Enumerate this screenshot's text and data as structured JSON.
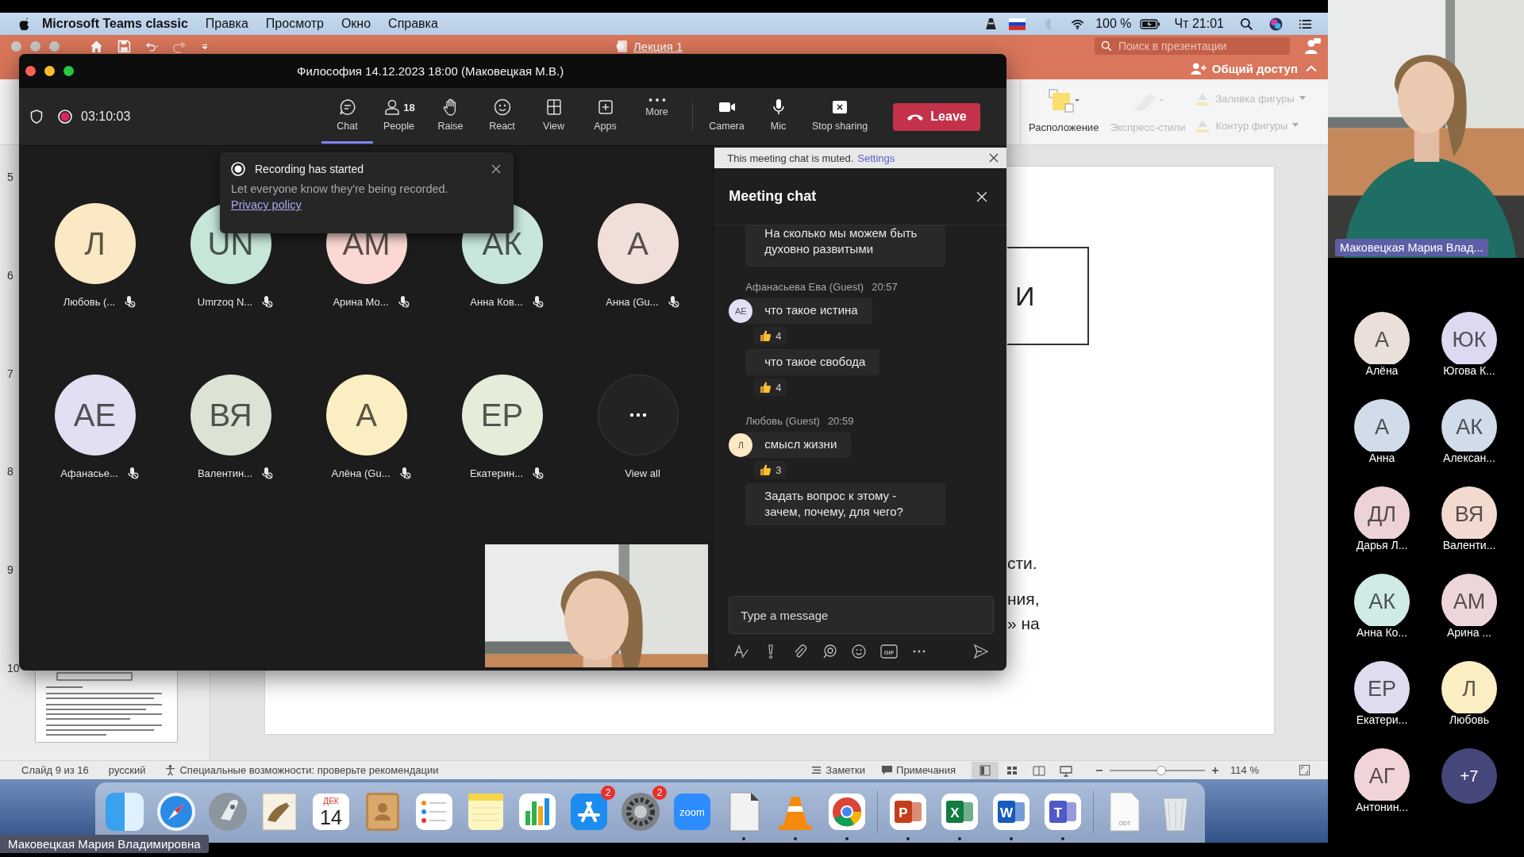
{
  "menu_bar": {
    "app": "Microsoft Teams classic",
    "menus": [
      "Правка",
      "Просмотр",
      "Окно",
      "Справка"
    ],
    "battery": "100 %",
    "clock": "Чт 21:01"
  },
  "powerpoint": {
    "title": "Лекция 1",
    "search": {
      "placeholder": "Поиск в презентации"
    },
    "share": "Общий доступ",
    "ribbon": [
      {
        "label": "Расположение",
        "disabled": false
      },
      {
        "label": "Экспресс-стили",
        "disabled": true
      },
      {
        "label": "Заливка фигуры",
        "disabled": true
      },
      {
        "label": "Контур фигуры",
        "disabled": true
      }
    ],
    "slides": [
      {
        "number": "5"
      },
      {
        "number": "6"
      },
      {
        "number": "7"
      },
      {
        "number": "8"
      },
      {
        "number": "9"
      },
      {
        "number": "10",
        "thumbnail_visible": true
      }
    ],
    "slide": {
      "box_text": "И",
      "lines": [
        "сти.",
        "ния,",
        "» на"
      ]
    },
    "status_bar": {
      "slide": "Слайд 9 из 16",
      "language": "русский",
      "accessibility": "Специальные возможности: проверьте рекомендации",
      "notes": "Заметки",
      "comments": "Примечания",
      "zoom": {
        "level": 0.54
      },
      "zoom_value": "114 %"
    }
  },
  "dock": [
    {
      "kind": "finder",
      "running": false
    },
    {
      "kind": "safari",
      "running": false
    },
    {
      "kind": "launchpad",
      "running": false
    },
    {
      "kind": "mail",
      "running": false
    },
    {
      "kind": "calendar",
      "running": false,
      "month": "ДЕК",
      "day": "14"
    },
    {
      "kind": "contacts",
      "running": false
    },
    {
      "kind": "reminders",
      "running": false
    },
    {
      "kind": "notes",
      "running": false
    },
    {
      "kind": "numbers",
      "running": false
    },
    {
      "kind": "appstore",
      "running": false,
      "badge": "2"
    },
    {
      "kind": "settings",
      "running": false,
      "badge": "2"
    },
    {
      "kind": "zoom",
      "running": false,
      "label": "zoom"
    },
    {
      "kind": "office",
      "running": true
    },
    {
      "kind": "vlc",
      "running": true
    },
    {
      "kind": "chrome",
      "running": true
    },
    {
      "kind": "separator"
    },
    {
      "kind": "letter",
      "running": true,
      "label": "P",
      "color": "#c43e1c"
    },
    {
      "kind": "letter",
      "running": true,
      "label": "X",
      "color": "#107c41"
    },
    {
      "kind": "letter",
      "running": true,
      "label": "W",
      "color": "#185abd"
    },
    {
      "kind": "letter",
      "running": true,
      "label": "T",
      "color": "#5059c9"
    },
    {
      "kind": "separator"
    },
    {
      "kind": "file",
      "running": false,
      "label": "ODT"
    },
    {
      "kind": "trash",
      "running": false
    }
  ],
  "teams": {
    "title": "Философия 14.12.2023 18:00 (Маковецкая М.В.)",
    "timer": "03:10:03",
    "toolbar": [
      {
        "kind": "chat",
        "label": "Chat",
        "selected": true
      },
      {
        "kind": "people",
        "label": "People",
        "count": "18",
        "selected": false
      },
      {
        "kind": "raise",
        "label": "Raise",
        "selected": false
      },
      {
        "kind": "react",
        "label": "React",
        "selected": false
      },
      {
        "kind": "view",
        "label": "View",
        "selected": false
      },
      {
        "kind": "apps",
        "label": "Apps",
        "selected": false
      },
      {
        "kind": "more",
        "label": "More",
        "selected": false
      },
      {
        "kind": "camera",
        "label": "Camera",
        "selected": false
      },
      {
        "kind": "mic",
        "label": "Mic",
        "selected": false
      },
      {
        "kind": "stop",
        "label": "Stop sharing",
        "selected": false
      }
    ],
    "leave": "Leave",
    "toast": {
      "title": "Recording has started",
      "text": "Let everyone know they're being recorded.",
      "link": "Privacy policy"
    },
    "participants": [
      {
        "initials": "Л",
        "name": "Любовь (...",
        "color": "#fbe9c6"
      },
      {
        "initials": "UN",
        "name": "Umrzoq N...",
        "color": "#c6e6d8"
      },
      {
        "initials": "АМ",
        "name": "Арина Мо...",
        "color": "#fcd8d2"
      },
      {
        "initials": "АК",
        "name": "Анна Ков...",
        "color": "#c8e6dc"
      },
      {
        "initials": "А",
        "name": "Анна (Gu...",
        "color": "#efdfd8"
      },
      {
        "initials": "АЕ",
        "name": "Афанасье...",
        "color": "#e3dff3"
      },
      {
        "initials": "ВЯ",
        "name": "Валентин...",
        "color": "#dbe3d4"
      },
      {
        "initials": "А",
        "name": "Алёна (Gu...",
        "color": "#fbeec2"
      },
      {
        "initials": "ЕР",
        "name": "Екатерин...",
        "color": "#e3edda"
      }
    ],
    "view_all": "View all",
    "chat": {
      "banner": "This meeting chat is muted.",
      "banner_link": "Settings",
      "title": "Meeting chat",
      "groups": [
        {
          "messages": [
            {
              "text": "На сколько мы можем быть духовно развитыми"
            }
          ]
        },
        {
          "sender": "Афанасьева Ева (Guest)",
          "time": "20:57",
          "initials": "АЕ",
          "color": "#e3dff3",
          "messages": [
            {
              "text": "что такое истина",
              "likes": "4"
            },
            {
              "text": "что такое свобода",
              "likes": "4"
            }
          ]
        },
        {
          "sender": "Любовь (Guest)",
          "time": "20:59",
          "initials": "Л",
          "color": "#fbe9c6",
          "messages": [
            {
              "text": "смысл жизни",
              "likes": "3"
            },
            {
              "text": "Задать вопрос к этому - зачем, почему, для чего?"
            }
          ]
        }
      ],
      "input": {
        "placeholder": "Type a message"
      },
      "gif": "GIF"
    }
  },
  "stage": {
    "presenter": "Маковецкая Мария Влад...",
    "tiles": [
      {
        "initials": "А",
        "name": "Алёна",
        "color": "#ebdfd9"
      },
      {
        "initials": "ЮК",
        "name": "Югова К...",
        "color": "#dcdaf0"
      },
      {
        "initials": "А",
        "name": "Анна",
        "color": "#d0dcea"
      },
      {
        "initials": "АК",
        "name": "Алексан...",
        "color": "#d0dcea"
      },
      {
        "initials": "ДЛ",
        "name": "Дарья Л...",
        "color": "#edd3d7"
      },
      {
        "initials": "ВЯ",
        "name": "Валенти...",
        "color": "#f3dad1"
      },
      {
        "initials": "АК",
        "name": "Анна Ко...",
        "color": "#d0eae5"
      },
      {
        "initials": "АМ",
        "name": "Арина ...",
        "color": "#edd6d9"
      },
      {
        "initials": "ЕР",
        "name": "Екатери...",
        "color": "#dfdcf0"
      },
      {
        "initials": "Л",
        "name": "Любовь",
        "color": "#fbeec2"
      },
      {
        "initials": "АГ",
        "name": "Антонин...",
        "color": "#f0d4d7"
      },
      {
        "kind": "more",
        "initials": "+7",
        "color": "#45467a"
      }
    ]
  },
  "share_label": "Маковецкая Мария Владимировна"
}
